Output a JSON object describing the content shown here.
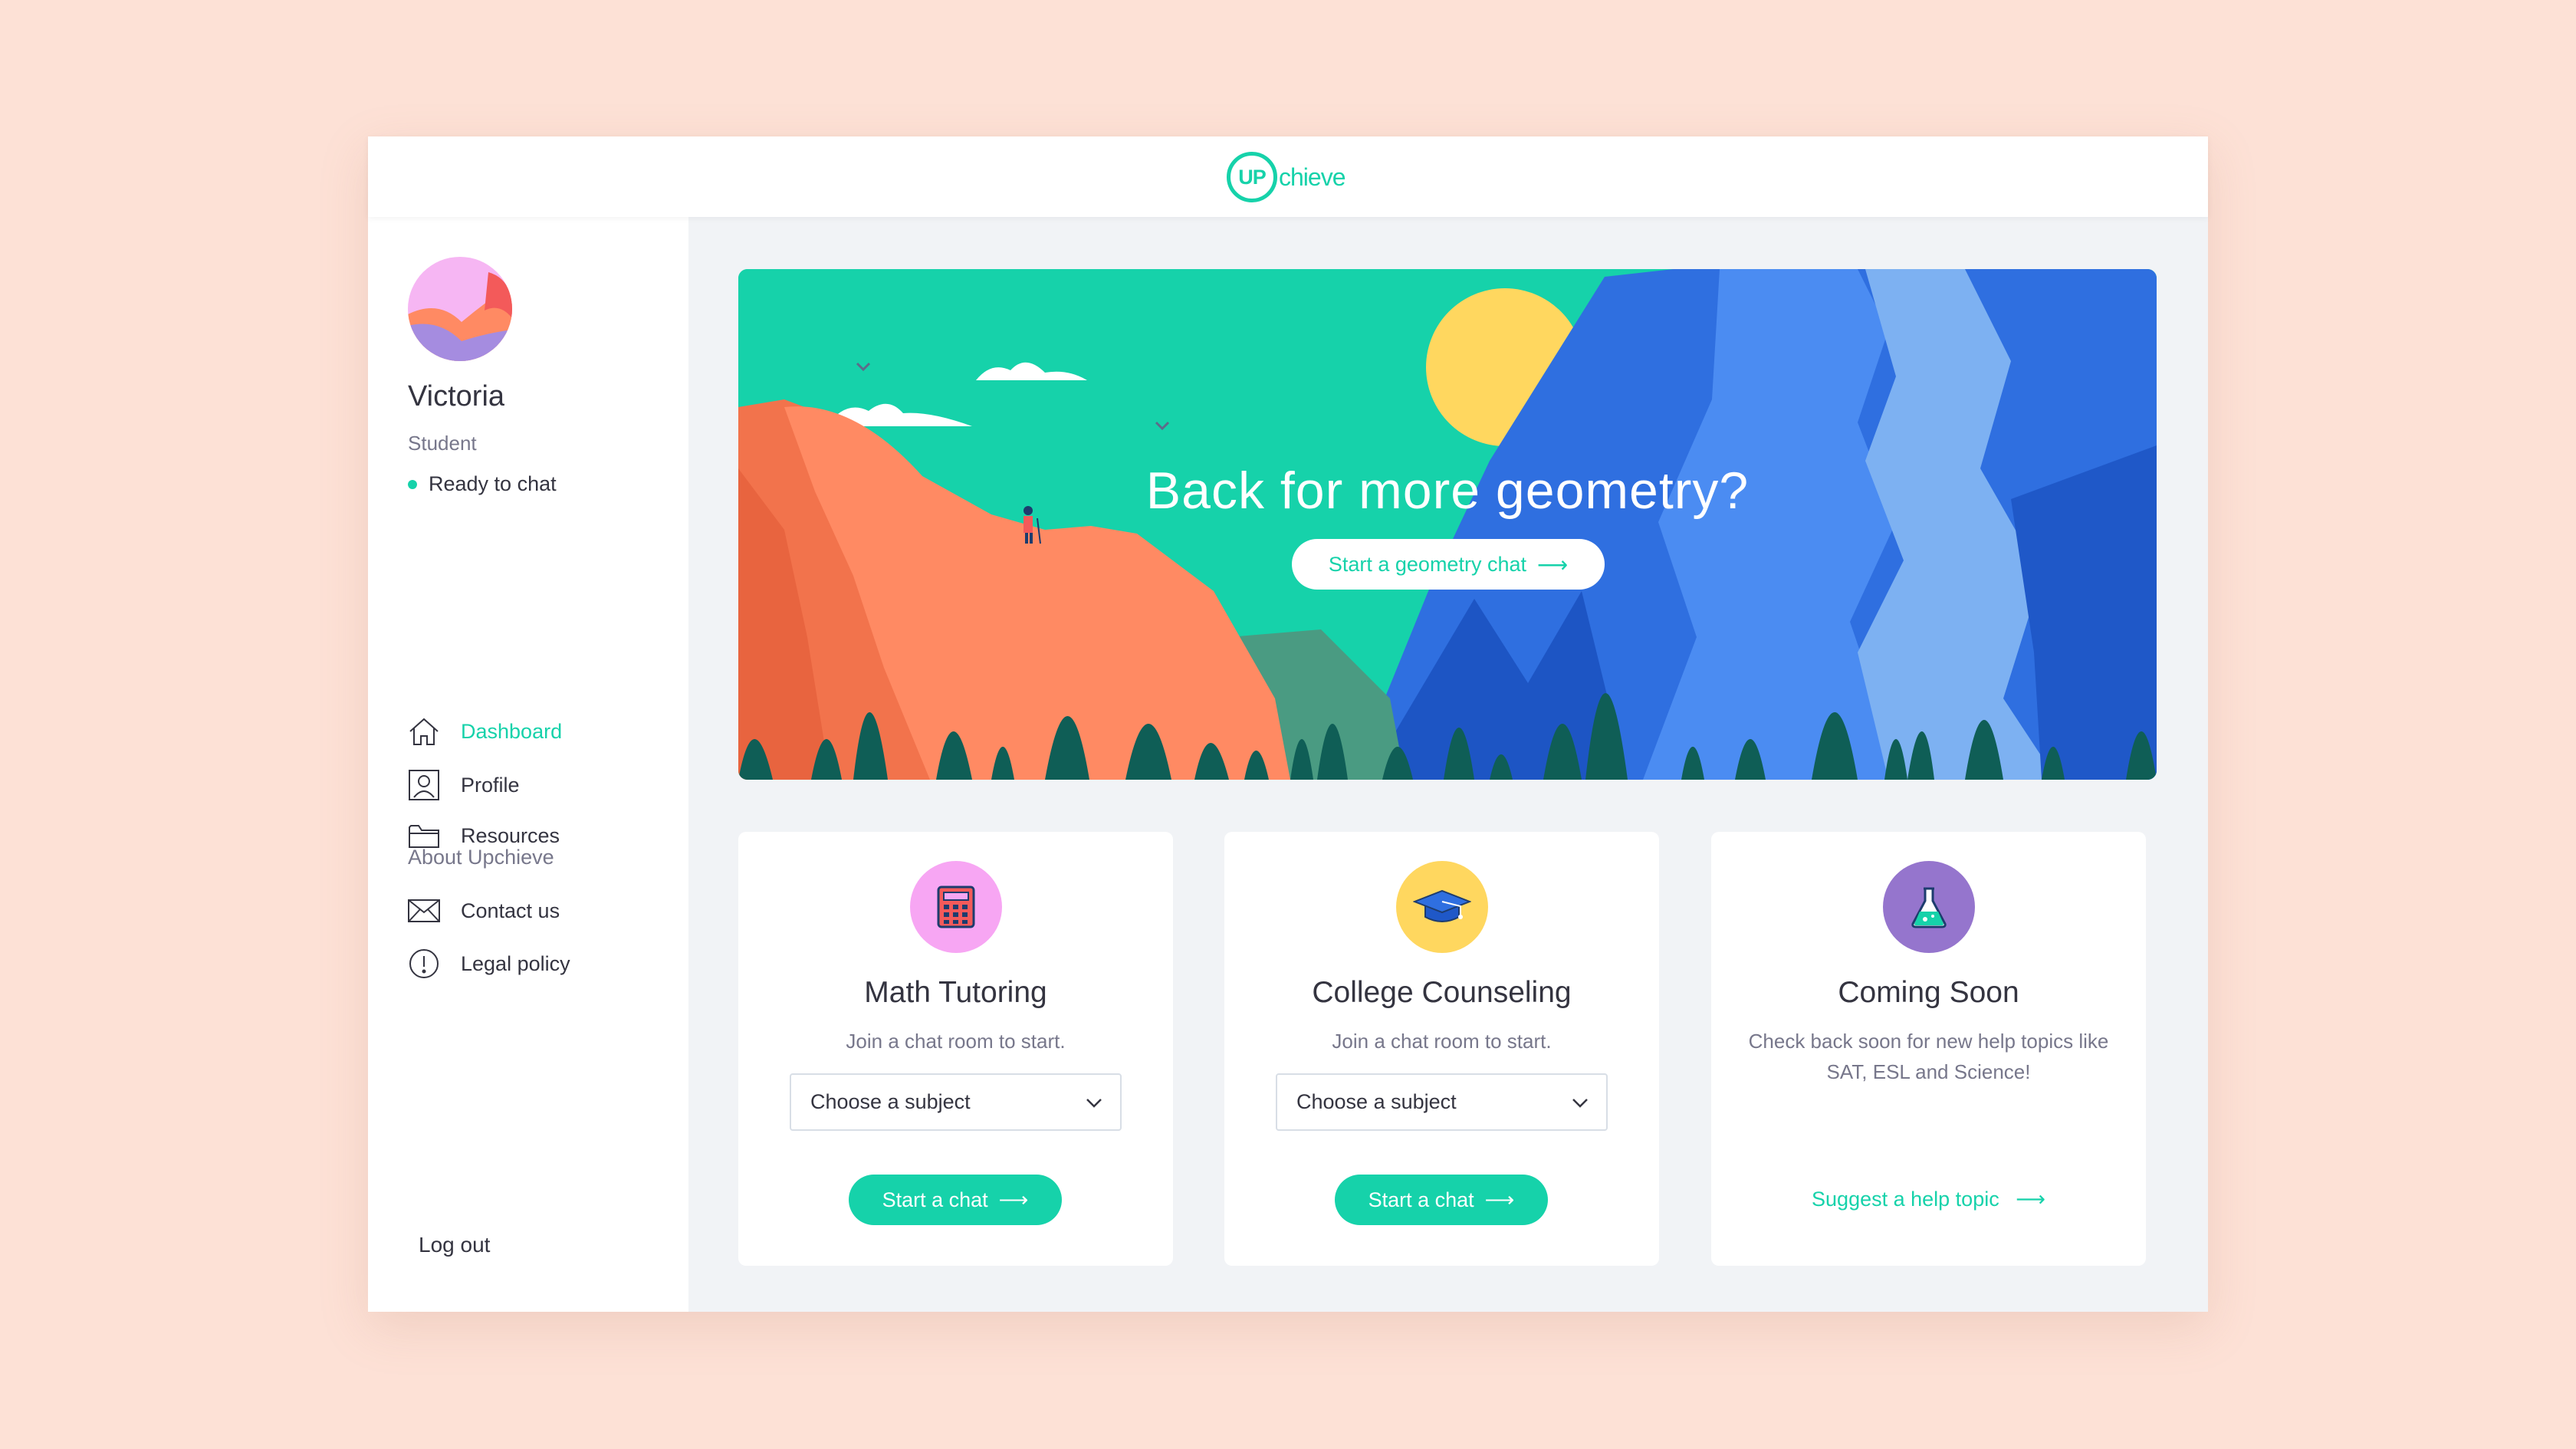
{
  "header": {
    "logo_mark": "UP",
    "logo_text": "chieve"
  },
  "user": {
    "name": "Victoria",
    "role": "Student",
    "status": "Ready to chat"
  },
  "nav": {
    "items": [
      {
        "label": "Dashboard",
        "icon": "home-icon",
        "active": true
      },
      {
        "label": "Profile",
        "icon": "profile-icon",
        "active": false
      },
      {
        "label": "Resources",
        "icon": "folder-icon",
        "active": false
      }
    ],
    "section_label": "About Upchieve",
    "about_items": [
      {
        "label": "Contact us",
        "icon": "mail-icon"
      },
      {
        "label": "Legal policy",
        "icon": "info-icon"
      }
    ],
    "logout": "Log out"
  },
  "hero": {
    "title": "Back for more geometry?",
    "button": "Start a geometry chat",
    "arrow": "⟶"
  },
  "cards": [
    {
      "title": "Math Tutoring",
      "subtitle": "Join a chat room to start.",
      "select_value": "Choose a subject",
      "button": "Start a chat",
      "icon": "calculator-icon",
      "icon_bg": "#f7a6f3"
    },
    {
      "title": "College Counseling",
      "subtitle": "Join a chat room to start.",
      "select_value": "Choose a subject",
      "button": "Start a chat",
      "icon": "graduation-cap-icon",
      "icon_bg": "#ffd75f"
    },
    {
      "title": "Coming Soon",
      "subtitle": "Check back soon for new help topics like SAT, ESL and Science!",
      "link": "Suggest a help topic",
      "icon": "flask-icon",
      "icon_bg": "#9575cd"
    }
  ],
  "colors": {
    "accent": "#16d2aa",
    "background": "#fde1d6",
    "text": "#343440",
    "muted": "#77778b"
  }
}
